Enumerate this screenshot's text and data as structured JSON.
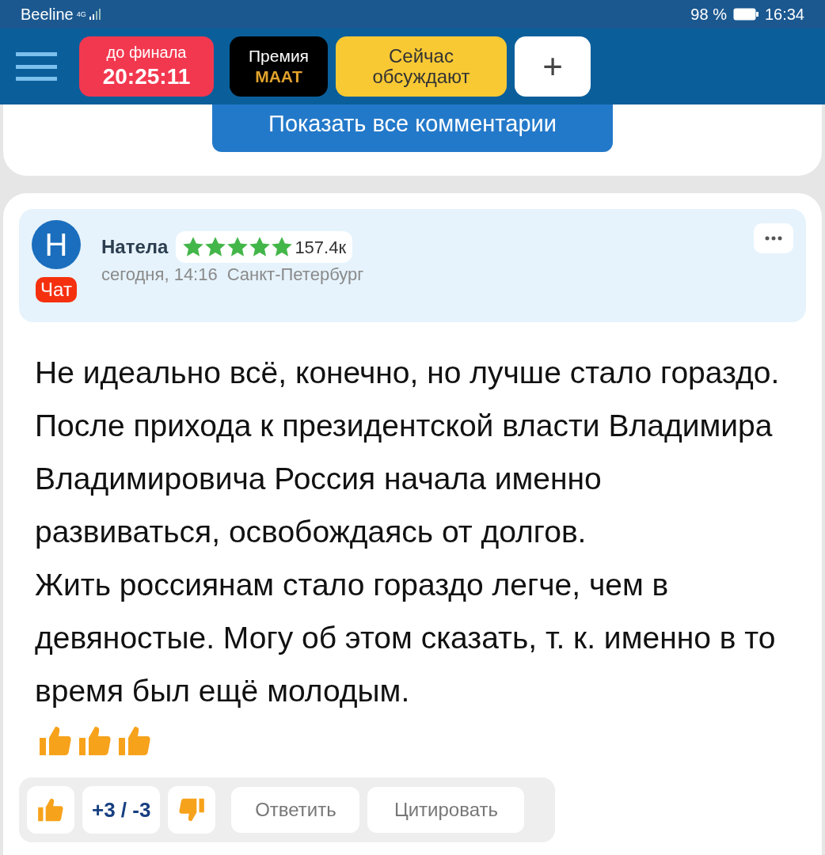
{
  "status_bar": {
    "carrier": "Beeline",
    "network": "4G",
    "battery": "98 %",
    "time": "16:34"
  },
  "header": {
    "countdown": {
      "label": "до финала",
      "time": "20:25:11"
    },
    "award": {
      "line1": "Премия",
      "line2": "МААТ"
    },
    "discussed": {
      "label": "Сейчас обсуждают"
    },
    "add": "+"
  },
  "show_all_button": "Показать все комментарии",
  "comment": {
    "avatar_letter": "Н",
    "badge": "Чат",
    "author": "Натела",
    "stars": 5,
    "rating": "157.4к",
    "date": "сегодня, 14:16",
    "city": "Санкт-Петербург",
    "paragraphs": [
      "Не идеально всё, конечно, но лучше стало гораздо.",
      "После прихода к президентской власти Владимира Владимировича Россия начала именно развиваться, освобождаясь от долгов.",
      "Жить россиянам стало гораздо легче, чем в девяностые. Могу об этом сказать, т. к. именно в то время был ещё молодым."
    ],
    "emoji": [
      {
        "kind": "thumbs_up"
      },
      {
        "kind": "thumbs_up"
      },
      {
        "kind": "thumbs_up"
      }
    ],
    "votes": "+3 / -3",
    "reply": "Ответить",
    "quote": "Цитировать"
  }
}
